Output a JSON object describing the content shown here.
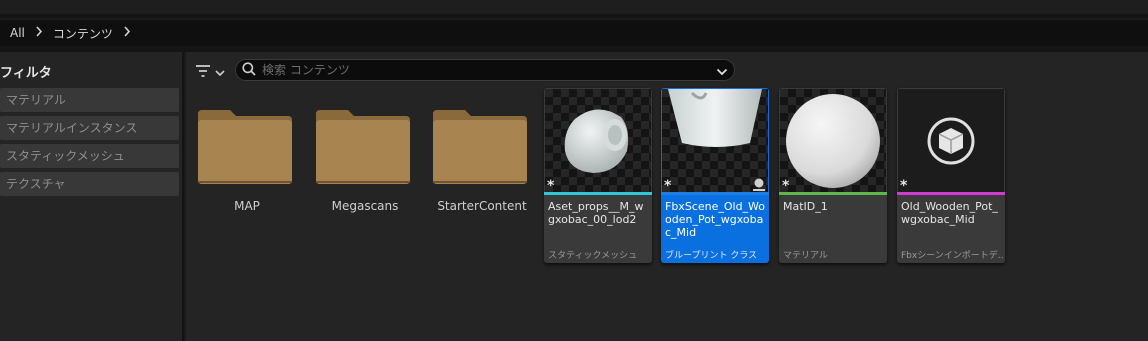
{
  "breadcrumb": {
    "items": [
      "All",
      "コンテンツ"
    ]
  },
  "filters": {
    "title": "フィルタ",
    "items": [
      "マテリアル",
      "マテリアルインスタンス",
      "スタティックメッシュ",
      "テクスチャ"
    ]
  },
  "search": {
    "placeholder": "検索 コンテンツ"
  },
  "folders": [
    {
      "name": "MAP"
    },
    {
      "name": "Megascans"
    },
    {
      "name": "StarterContent"
    }
  ],
  "assets": [
    {
      "name": "Aset_props__M_wgxobac_00_lod2",
      "type": "スタティックメッシュ",
      "color": "#2fc6d6"
    },
    {
      "name": "FbxScene_Old_Wooden_Pot_wgxobac_Mid",
      "type": "ブループリント クラス",
      "color": "#1f7de6"
    },
    {
      "name": "MatID_1",
      "type": "マテリアル",
      "color": "#5cb84a"
    },
    {
      "name": "Old_Wooden_Pot_wgxobac_Mid",
      "type": "Fbxシーンインポートデ...",
      "color": "#d23ad6"
    }
  ],
  "colors": {
    "folder": "#a88450",
    "selection": "#0a70e0"
  },
  "icons": [
    "chevron-right-icon",
    "filter-icon",
    "chevron-down-icon",
    "search-icon",
    "folder-icon",
    "star-icon",
    "blueprint-icon",
    "cube-icon"
  ]
}
